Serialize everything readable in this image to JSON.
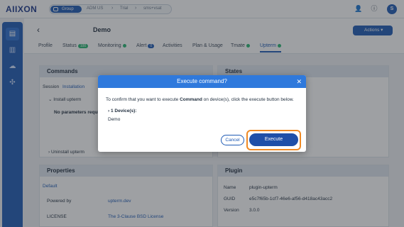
{
  "topbar": {
    "logo": "AIIXON",
    "breadcrumb": [
      "Group",
      "ADM US",
      "Trial",
      "sms+vsat"
    ],
    "icons": [
      "user-add-icon",
      "info-icon"
    ],
    "avatar": "S"
  },
  "sidebar": {
    "items": [
      "dashboard-icon",
      "chart-icon",
      "cloud-icon",
      "puzzle-icon"
    ]
  },
  "header": {
    "title": "Demo",
    "actions_label": "Actions",
    "tabs": [
      {
        "label": "Profile"
      },
      {
        "label": "Status",
        "badge": "100"
      },
      {
        "label": "Monitoring"
      },
      {
        "label": "Alert",
        "badge": "0"
      },
      {
        "label": "Activities"
      },
      {
        "label": "Plan & Usage"
      },
      {
        "label": "Tmate"
      },
      {
        "label": "Upterm"
      }
    ]
  },
  "commands": {
    "title": "Commands",
    "session_label": "Session",
    "session_value": "Installation",
    "item1": "Install upterm",
    "no_params": "No parameters requi",
    "item2": "Uninstall upterm"
  },
  "states": {
    "title": "States"
  },
  "properties": {
    "title": "Properties",
    "default": "Default",
    "rows": [
      {
        "label": "Powered by",
        "value": "upterm.dev"
      },
      {
        "label": "LICENSE",
        "value": "The 3-Clause BSD License"
      }
    ]
  },
  "plugin": {
    "title": "Plugin",
    "rows": [
      {
        "label": "Name",
        "value": "plugin-upterm"
      },
      {
        "label": "GUID",
        "value": "e5c7f65b-1cf7-46e6-af56-d418ac43acc2"
      },
      {
        "label": "Version",
        "value": "3.0.0"
      }
    ]
  },
  "modal": {
    "title": "Execute command?",
    "msg_pre": "To confirm that you want to execute ",
    "msg_bold": "Command",
    "msg_post": " on device(s), click the execute button below.",
    "devices_label": "1 Device(s):",
    "device": "Demo",
    "cancel": "Cancel",
    "execute": "Execute"
  },
  "colors": {
    "primary": "#1f5bb5",
    "modal_header": "#2f79dc",
    "highlight": "#f08a24",
    "ok_dot": "#2bb673"
  }
}
